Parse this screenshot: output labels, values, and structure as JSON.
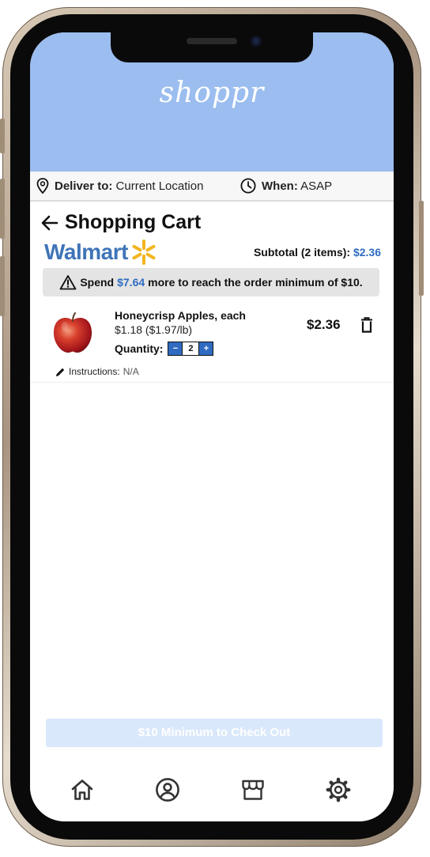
{
  "app": {
    "brand": "shoppr"
  },
  "deliver": {
    "label": "Deliver to:",
    "value": "Current Location",
    "when_label": "When:",
    "when_value": "ASAP"
  },
  "cart": {
    "title": "Shopping Cart"
  },
  "store": {
    "name": "Walmart",
    "subtotal_label": "Subtotal (2 items):",
    "subtotal_value": "$2.36"
  },
  "banner": {
    "prefix": "Spend",
    "amount": "$7.64",
    "suffix": "more to reach the order minimum of $10."
  },
  "items": [
    {
      "name": "Honeycrisp Apples, each",
      "unit_price": "$1.18 ($1.97/lb)",
      "quantity_label": "Quantity:",
      "minus": "−",
      "quantity": "2",
      "plus": "+",
      "price": "$2.36",
      "instructions_label": "Instructions:",
      "instructions_value": "N/A"
    }
  ],
  "checkout": {
    "label": "$10 Minimum to Check Out"
  },
  "nav": {
    "icons": [
      "home-icon",
      "profile-icon",
      "store-icon",
      "gear-icon"
    ]
  },
  "colors": {
    "header": "#9bbdef",
    "accent": "#2f6bc1",
    "walmart_blue": "#3f74b8",
    "walmart_spark": "#f2b51f",
    "checkout_disabled": "#dae8fb"
  }
}
